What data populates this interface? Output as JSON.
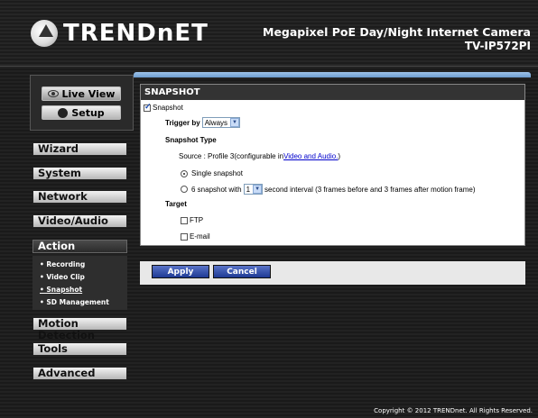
{
  "header": {
    "brand": "TRENDnET",
    "product_name": "Megapixel PoE Day/Night Internet Camera",
    "model": "TV-IP572PI"
  },
  "top_buttons": {
    "live_view": "Live View",
    "setup": "Setup"
  },
  "menu": {
    "wizard": "Wizard",
    "system": "System",
    "network": "Network",
    "video_audio": "Video/Audio",
    "action": "Action",
    "motion_detection": "Motion Detection",
    "tools": "Tools",
    "advanced": "Advanced"
  },
  "submenu": {
    "recording": "• Recording",
    "video_clip": "• Video Clip",
    "snapshot": "• Snapshot",
    "sd_management": "• SD Management"
  },
  "panel": {
    "title": "SNAPSHOT",
    "snapshot_label": "Snapshot",
    "trigger_label": "Trigger by",
    "trigger_value": "Always",
    "snapshot_type_label": "Snapshot Type",
    "source_prefix": "Source : Profile 3(configurable in ",
    "source_link": "Video and Audio.",
    "source_suffix": ")",
    "single_snapshot": "Single snapshot",
    "six_prefix": "6 snapshot with",
    "interval_value": "1",
    "six_suffix": "second interval (3 frames before and 3 frames after motion frame)",
    "target_label": "Target",
    "ftp_label": "FTP",
    "email_label": "E-mail"
  },
  "actions": {
    "apply": "Apply",
    "cancel": "Cancel"
  },
  "footer": {
    "copyright": "Copyright © 2012 TRENDnet. All Rights Reserved."
  }
}
